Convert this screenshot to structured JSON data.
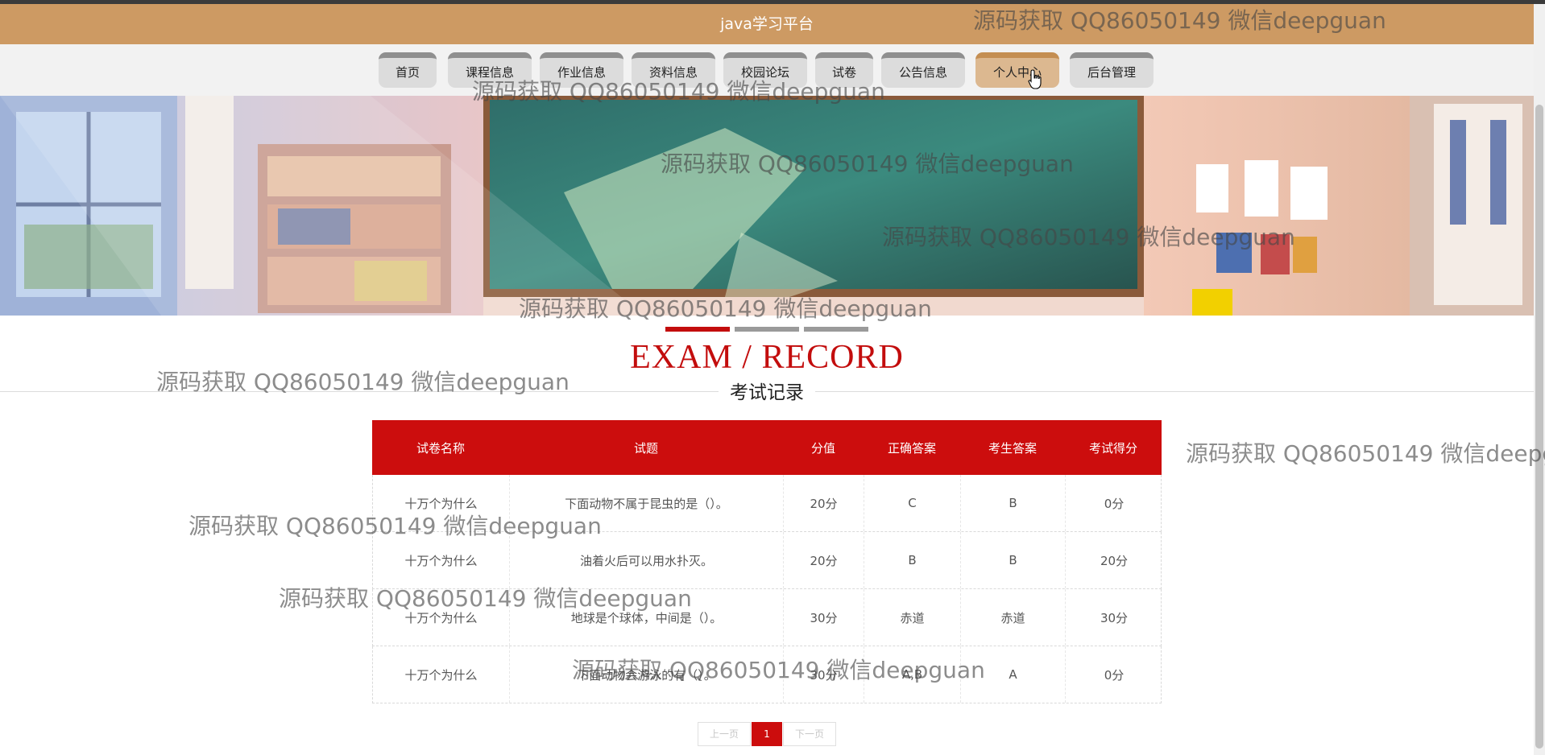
{
  "header": {
    "site_title": "java学习平台"
  },
  "nav": {
    "items": [
      {
        "label": "首页"
      },
      {
        "label": "课程信息"
      },
      {
        "label": "作业信息"
      },
      {
        "label": "资料信息"
      },
      {
        "label": "校园论坛"
      },
      {
        "label": "试卷"
      },
      {
        "label": "公告信息"
      },
      {
        "label": "个人中心"
      },
      {
        "label": "后台管理"
      }
    ],
    "active_label": "个人中心"
  },
  "section": {
    "title_en": "EXAM / RECORD",
    "title_cn": "考试记录"
  },
  "table": {
    "headers": [
      "试卷名称",
      "试题",
      "分值",
      "正确答案",
      "考生答案",
      "考试得分"
    ],
    "rows": [
      [
        "十万个为什么",
        "下面动物不属于昆虫的是（）。",
        "20分",
        "C",
        "B",
        "0分"
      ],
      [
        "十万个为什么",
        "油着火后可以用水扑灭。",
        "20分",
        "B",
        "B",
        "20分"
      ],
      [
        "十万个为什么",
        "地球是个球体，中间是（）。",
        "30分",
        "赤道",
        "赤道",
        "30分"
      ],
      [
        "十万个为什么",
        "下面动物会游泳的有（）。",
        "30分",
        "A,B",
        "A",
        "0分"
      ]
    ]
  },
  "pagination": {
    "prev": "上一页",
    "current": "1",
    "next": "下一页"
  },
  "watermark": {
    "text": "源码获取 QQ86050149 微信deepguan"
  },
  "colors": {
    "header_bg": "#cd9a63",
    "accent_red": "#cc0d0d",
    "nav_active": "#dcb890"
  }
}
